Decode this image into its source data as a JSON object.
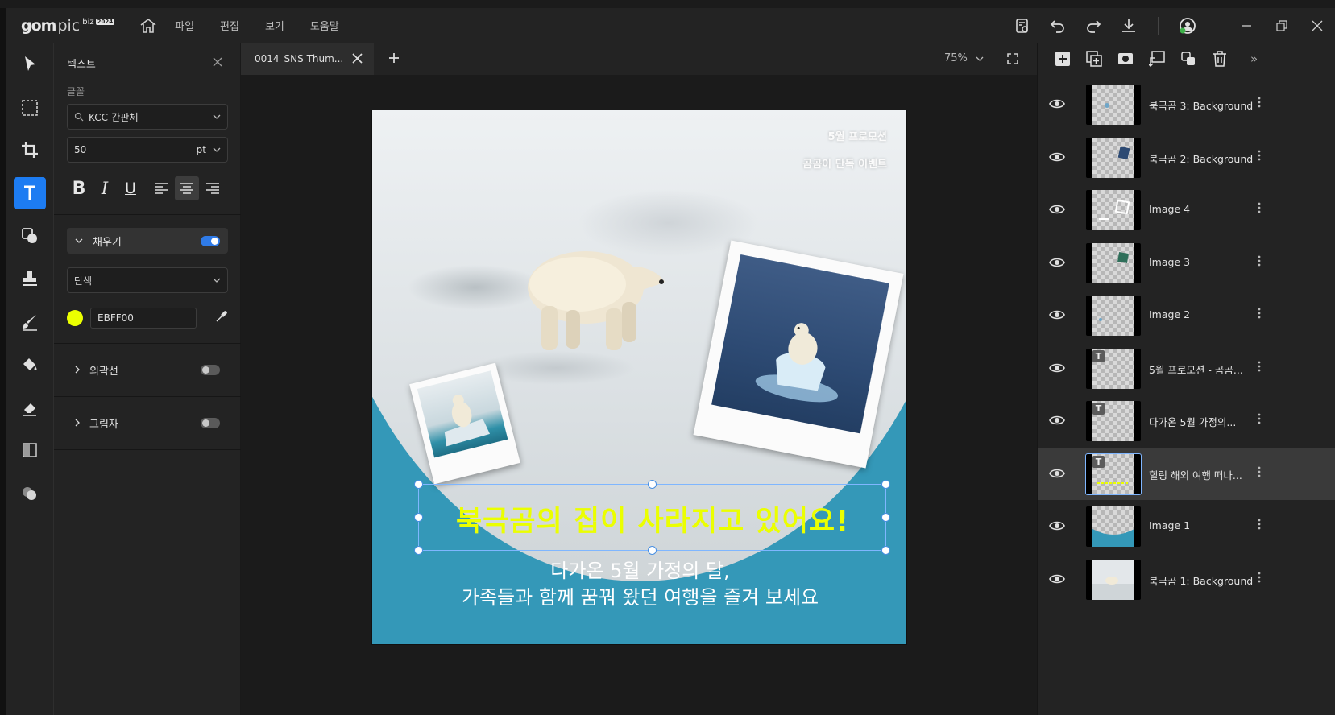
{
  "app": {
    "logo_gom": "gom",
    "logo_pic": "pic",
    "logo_biz": "biz",
    "logo_ver": "2024",
    "menu": [
      "파일",
      "편집",
      "보기",
      "도움말"
    ]
  },
  "panel": {
    "title": "텍스트",
    "font_label": "글꼴",
    "font_value": "KCC-간판체",
    "size_value": "50",
    "size_unit": "pt",
    "format": {
      "bold": "B",
      "italic": "I",
      "underline": "U"
    },
    "fill": {
      "label": "채우기",
      "enabled": true,
      "mode": "단색",
      "color_hex": "EBFF00",
      "color": "#ebff00"
    },
    "stroke": {
      "label": "외곽선",
      "enabled": false
    },
    "shadow": {
      "label": "그림자",
      "enabled": false
    }
  },
  "tabs": {
    "active": "0014_SNS Thum...",
    "zoom": "75%"
  },
  "artboard": {
    "promo_line1": "5월 프로모션",
    "promo_line2": "곰곰이 단독 이벤트",
    "headline": "북극곰의 집이 사라지고 있어요!",
    "sub_line1": "다가온 5월 가정의 달,",
    "sub_line2": "가족들과 함께 꿈꿔 왔던 여행을 즐겨 보세요",
    "bg_color": "#3498b8"
  },
  "layers": [
    {
      "name": "북극곰 3: Background",
      "type": "image",
      "selected": false
    },
    {
      "name": "북극곰 2: Background",
      "type": "image",
      "selected": false
    },
    {
      "name": "Image 4",
      "type": "image",
      "selected": false
    },
    {
      "name": "Image 3",
      "type": "image",
      "selected": false
    },
    {
      "name": "Image 2",
      "type": "image",
      "selected": false
    },
    {
      "name": "5월 프로모션 - 곰곰...",
      "type": "text",
      "selected": false
    },
    {
      "name": "다가온 5월 가정의...",
      "type": "text",
      "selected": false
    },
    {
      "name": "힐링 해외 여행 떠나...",
      "type": "text",
      "selected": true
    },
    {
      "name": "Image 1",
      "type": "image",
      "selected": false
    },
    {
      "name": "북극곰 1: Background",
      "type": "image",
      "selected": false
    }
  ],
  "colors": {
    "accent": "#1d7cf2",
    "panel_bg": "#232323",
    "app_bg": "#1b1b1b"
  }
}
